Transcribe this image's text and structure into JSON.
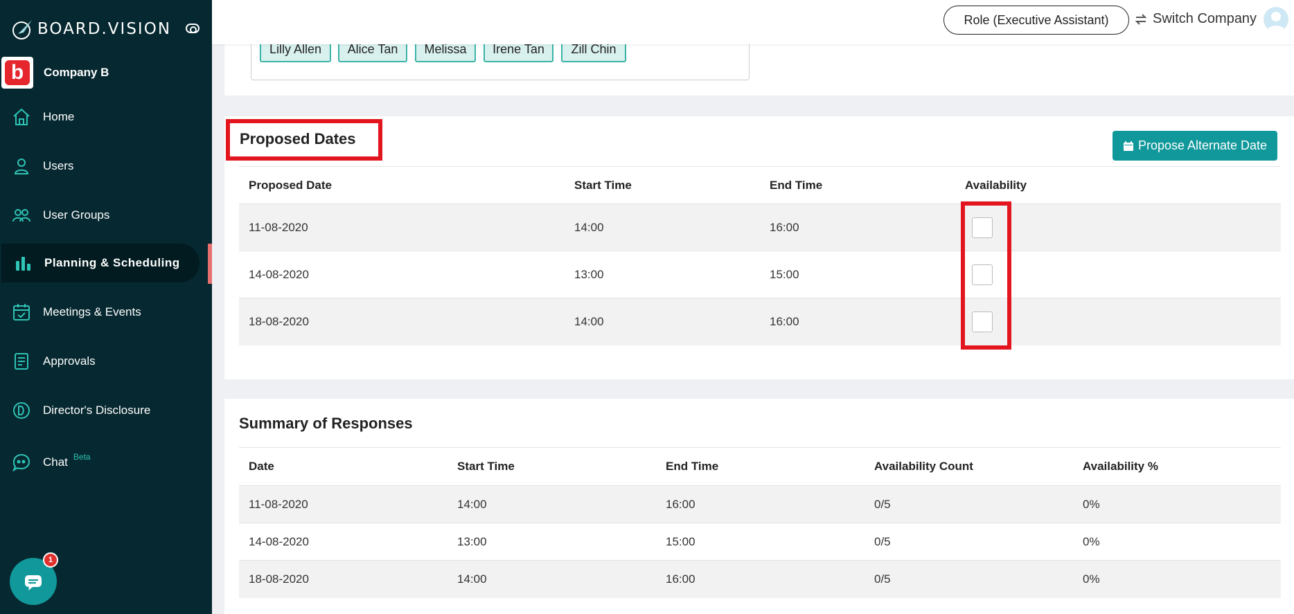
{
  "brand": {
    "name": "BOARD.VISION"
  },
  "company": {
    "name": "Company B",
    "initial": "b"
  },
  "sidebar": {
    "items": [
      {
        "label": "Home",
        "icon": "home-icon"
      },
      {
        "label": "Users",
        "icon": "user-icon"
      },
      {
        "label": "User Groups",
        "icon": "users-icon"
      },
      {
        "label": "Planning & Scheduling",
        "icon": "bar-chart-icon",
        "active": true
      },
      {
        "label": "Meetings & Events",
        "icon": "calendar-check-icon"
      },
      {
        "label": "Approvals",
        "icon": "document-icon"
      },
      {
        "label": "Director's Disclosure",
        "icon": "d-circle-icon"
      },
      {
        "label": "Chat",
        "icon": "chat-bubble-icon",
        "badge": "Beta"
      }
    ]
  },
  "chat_fab": {
    "count": "1"
  },
  "topbar": {
    "role_label": "Role (Executive Assistant)",
    "switch_label": "Switch Company"
  },
  "attendees": [
    "Lilly Allen",
    "Alice Tan",
    "Melissa",
    "Irene Tan",
    "Zill Chin"
  ],
  "proposed_dates": {
    "title": "Proposed Dates",
    "propose_button": "Propose Alternate Date",
    "columns": [
      "Proposed Date",
      "Start Time",
      "End Time",
      "Availability"
    ],
    "rows": [
      {
        "date": "11-08-2020",
        "start": "14:00",
        "end": "16:00",
        "available": false
      },
      {
        "date": "14-08-2020",
        "start": "13:00",
        "end": "15:00",
        "available": false
      },
      {
        "date": "18-08-2020",
        "start": "14:00",
        "end": "16:00",
        "available": false
      }
    ]
  },
  "summary": {
    "title": "Summary of Responses",
    "columns": [
      "Date",
      "Start Time",
      "End Time",
      "Availability Count",
      "Availability %"
    ],
    "rows": [
      {
        "date": "11-08-2020",
        "start": "14:00",
        "end": "16:00",
        "count": "0/5",
        "percent": "0%"
      },
      {
        "date": "14-08-2020",
        "start": "13:00",
        "end": "15:00",
        "count": "0/5",
        "percent": "0%"
      },
      {
        "date": "18-08-2020",
        "start": "14:00",
        "end": "16:00",
        "count": "0/5",
        "percent": "0%"
      }
    ]
  },
  "colors": {
    "sidebar": "#062830",
    "accent": "#11989b",
    "highlight": "#e3161f",
    "chip_border": "#3bb3a6"
  }
}
